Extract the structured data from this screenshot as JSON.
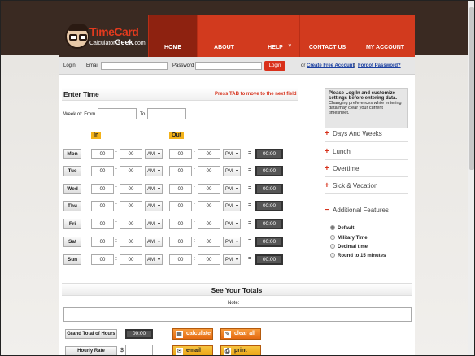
{
  "logo": {
    "title": "TimeCard",
    "sub_a": "Calculator",
    "sub_b": "Geek",
    "sub_c": ".com"
  },
  "nav": {
    "home": "HOME",
    "about": "ABOUT",
    "help": "HELP",
    "help_caret": "˅",
    "contact": "CONTACT US",
    "account": "MY ACCOUNT"
  },
  "login": {
    "login_label": "Login:",
    "email_label": "Email",
    "password_label": "Password",
    "button": "Login",
    "or": "or",
    "create": "Create Free Account",
    "sep": "|",
    "forgot": "Forgot Password?"
  },
  "enter_time": {
    "title": "Enter Time",
    "tip": "Press TAB to move to the next field",
    "week_from": "Week of: From",
    "to": "To",
    "in_label": "In",
    "out_label": "Out"
  },
  "rows": [
    {
      "day": "Mon",
      "in_h": "00",
      "in_m": "00",
      "in_ap": "AM",
      "out_h": "00",
      "out_m": "00",
      "out_ap": "PM",
      "total": "00:00"
    },
    {
      "day": "Tue",
      "in_h": "00",
      "in_m": "00",
      "in_ap": "AM",
      "out_h": "00",
      "out_m": "00",
      "out_ap": "PM",
      "total": "00:00"
    },
    {
      "day": "Wed",
      "in_h": "00",
      "in_m": "00",
      "in_ap": "AM",
      "out_h": "00",
      "out_m": "00",
      "out_ap": "PM",
      "total": "00:00"
    },
    {
      "day": "Thu",
      "in_h": "00",
      "in_m": "00",
      "in_ap": "AM",
      "out_h": "00",
      "out_m": "00",
      "out_ap": "PM",
      "total": "00:00"
    },
    {
      "day": "Fri",
      "in_h": "00",
      "in_m": "00",
      "in_ap": "AM",
      "out_h": "00",
      "out_m": "00",
      "out_ap": "PM",
      "total": "00:00"
    },
    {
      "day": "Sat",
      "in_h": "00",
      "in_m": "00",
      "in_ap": "AM",
      "out_h": "00",
      "out_m": "00",
      "out_ap": "PM",
      "total": "00:00"
    },
    {
      "day": "Sun",
      "in_h": "00",
      "in_m": "00",
      "in_ap": "AM",
      "out_h": "00",
      "out_m": "00",
      "out_ap": "PM",
      "total": "00:00"
    }
  ],
  "sidebar": {
    "note_title": "Please Log In and customize settings before entering data.",
    "note_body": "Changing preferences while entering data may clear your current timesheet.",
    "items": [
      {
        "sign": "+",
        "label": "Days And Weeks"
      },
      {
        "sign": "+",
        "label": "Lunch"
      },
      {
        "sign": "+",
        "label": "Overtime"
      },
      {
        "sign": "+",
        "label": "Sick & Vacation"
      },
      {
        "sign": "−",
        "label": "Additional Features"
      }
    ],
    "options": [
      {
        "label": "Default",
        "selected": true
      },
      {
        "label": "Military Time",
        "selected": false
      },
      {
        "label": "Decimal time",
        "selected": false
      },
      {
        "label": "Round to 15 minutes",
        "selected": false
      }
    ]
  },
  "totals": {
    "title": "See Your Totals",
    "note_label": "Note:",
    "grand_label": "Grand Total of Hours",
    "grand_value": "00:00",
    "rate_label": "Hourly Rate",
    "dollar": "$",
    "calculate": "calculate",
    "clear_all": "clear all",
    "email": "email",
    "print": "print"
  }
}
